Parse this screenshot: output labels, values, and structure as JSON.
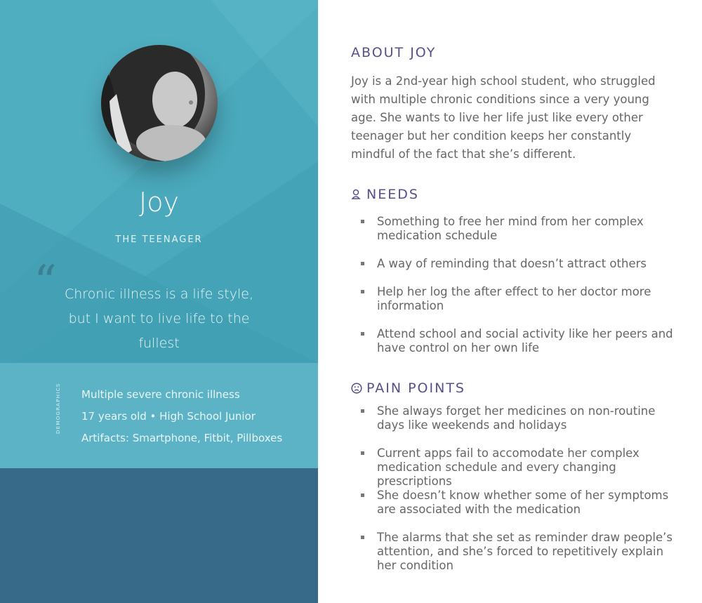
{
  "persona": {
    "name": "Joy",
    "role": "THE TEENAGER",
    "quote_mark": "“",
    "quote": "Chronic illness is a life style, but I want to live life to the fullest"
  },
  "demographics": {
    "label": "DEMOGRAPHICS",
    "items": [
      "Multiple severe chronic illness",
      "17 years old • High School Junior",
      "Artifacts: Smartphone, Fitbit, Pillboxes"
    ]
  },
  "about": {
    "title": "ABOUT JOY",
    "text": "Joy is a 2nd-year high school student, who struggled with multiple chronic conditions since a very young age. She wants to live her life just like every other teenager but her condition keeps her constantly mindful of the fact that she’s different."
  },
  "needs": {
    "title": "NEEDS",
    "icon": "person-icon",
    "items": [
      "Something to free her mind from her complex medication schedule",
      "A way of reminding that doesn’t attract others",
      "Help her log the after effect to her doctor more information",
      "Attend school and social activity like her peers and have control on her own life"
    ]
  },
  "pain_points": {
    "title": "PAIN POINTS",
    "icon": "sad-face-icon",
    "items": [
      "She always forget her medicines on non-routine days like weekends and holidays",
      "Current apps fail to accomodate her complex medication schedule and every changing prescriptions",
      "She doesn’t know whether some of her symptoms are associated with the medication",
      "The alarms that she set as reminder draw people’s attention, and she’s forced to repetitively explain her condition"
    ]
  },
  "colors": {
    "hero": "#4aa9bc",
    "demographics": "#5cb3c5",
    "footer": "#366a88",
    "heading": "#5a4f8a",
    "body_text": "#666666"
  }
}
